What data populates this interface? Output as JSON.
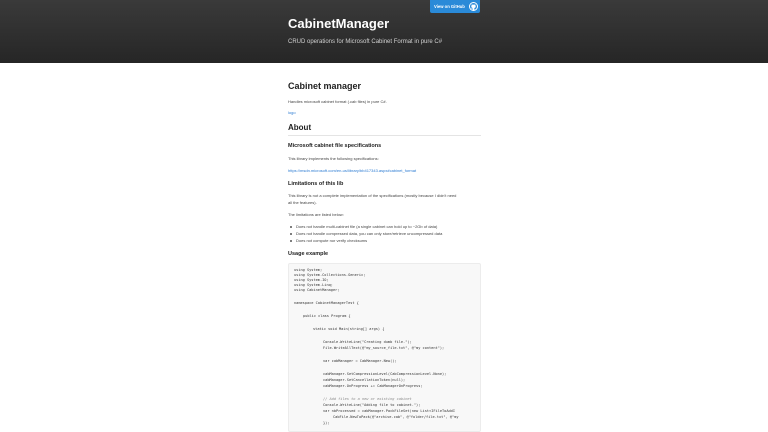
{
  "header": {
    "project_name": "CabinetManager",
    "tagline": "CRUD operations for Microsoft Cabinet Format in pure C#",
    "github_button": "View on GitHub"
  },
  "content": {
    "title": "Cabinet manager",
    "intro": "Handles microsoft cabinet format (.cab files) in pure C#.",
    "logo_link": "logo",
    "about_heading": "About",
    "spec_heading": "Microsoft cabinet file specifications",
    "spec_text": "This library implements the following specifications:",
    "spec_link": "https://msdn.microsoft.com/en-us/library/bb417343.aspx#cabinet_format",
    "limits_heading": "Limitations of this lib",
    "limits_text_1": "This library is not a complete implementation of the specifications (mostly because I didn't need",
    "limits_text_2": "all the features).",
    "limits_list_intro": "The limitations are listed below:",
    "limits": [
      "Does not handle multi-cabinet file (a single cabinet can hold up to ~2Gb of data)",
      "Does not handle compressed data, you can only store/retrieve uncompressed data",
      "Does not compute nor verify checksums"
    ],
    "usage_heading": "Usage example"
  },
  "code": {
    "u1": "using System;",
    "u2": "using System.Collections.Generic;",
    "u3": "using System.IO;",
    "u4": "using System.Linq;",
    "u5": "using CabinetManager;",
    "ns": "namespace CabinetManagerTest {",
    "cls": "public class Program {",
    "main": "static void Main(string[] args) {",
    "w1": "Console.WriteLine(\"Creating dumb file.\");",
    "w2": "File.WriteAllText(@\"my_source_file.txt\", @\"my content\");",
    "new": "var cabManager = CabManager.New();",
    "s1": "cabManager.SetCompressionLevel(CabCompressionLevel.None);",
    "s2": "cabManager.SetCancellationToken(null);",
    "s3": "cabManager.OnProgress += CabManagerOnProgress;",
    "cm": "// Add files to a new or existing cabinet",
    "w3": "Console.WriteLine(\"Adding file to cabinet.\");",
    "p1": "var nbProcessed = cabManager.PackFileSet(new List<IFileToAddI",
    "p2": "CabFile.NewToPack(@\"archive.cab\", @\"folder/file.txt\", @\"my",
    "p3": "});"
  }
}
